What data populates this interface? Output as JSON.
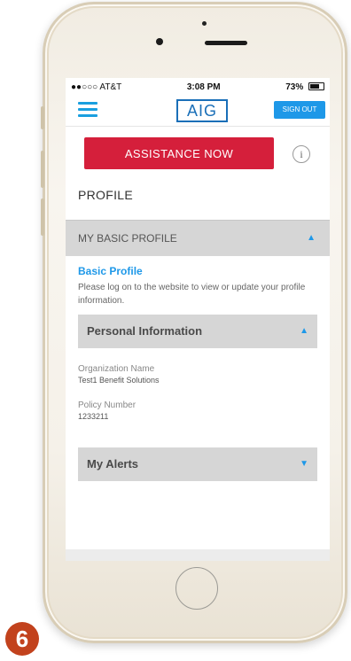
{
  "status_bar": {
    "carrier": "●●○○○ AT&T",
    "time": "3:08 PM",
    "battery": "73%"
  },
  "header": {
    "logo_text": "AIG",
    "sign_out_label": "SIGN OUT"
  },
  "assistance": {
    "button_label": "ASSISTANCE NOW",
    "info_icon": "i"
  },
  "page_title": "PROFILE",
  "sections": {
    "basic_profile_header": "MY BASIC PROFILE",
    "basic_profile_link": "Basic Profile",
    "note": "Please log on to the website to view or update your profile information.",
    "personal_info_header": "Personal Information",
    "fields": [
      {
        "label": "Organization Name",
        "value": "Test1 Benefit Solutions"
      },
      {
        "label": "Policy Number",
        "value": "1233211"
      }
    ],
    "alerts_header": "My Alerts"
  },
  "badge_number": "6",
  "colors": {
    "accent_blue": "#1e98e8",
    "assist_red": "#d51f3b",
    "badge": "#c2421d"
  }
}
